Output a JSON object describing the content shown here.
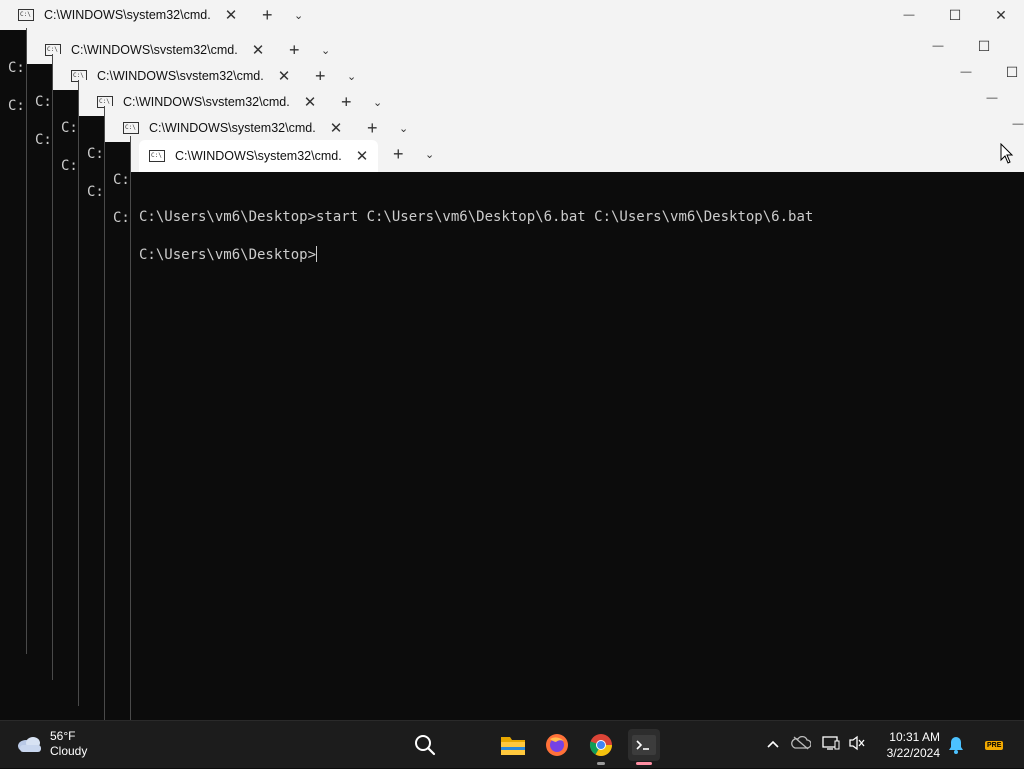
{
  "window_title": "C:\\WINDOWS\\system32\\cmd.",
  "background_peek_prompt": "C:",
  "console": {
    "line1": "C:\\Users\\vm6\\Desktop>start C:\\Users\\vm6\\Desktop\\6.bat C:\\Users\\vm6\\Desktop\\6.bat",
    "line2": "C:\\Users\\vm6\\Desktop>"
  },
  "tab_controls": {
    "close": "✕",
    "new_tab": "+",
    "dropdown": "⌄"
  },
  "window_controls": {
    "minimize": "—",
    "maximize": "☐",
    "close": "✕"
  },
  "taskbar": {
    "weather": {
      "temp": "56°F",
      "condition": "Cloudy"
    },
    "clock": {
      "time": "10:31 AM",
      "date": "3/22/2024"
    },
    "apps": [
      "search-icon",
      "file-explorer-icon",
      "firefox-icon",
      "chrome-icon",
      "terminal-icon"
    ],
    "badge": "PRE"
  },
  "colors": {
    "console_bg": "#0c0c0c",
    "console_fg": "#cccccc",
    "titlebar_bg": "#f3f3f3",
    "taskbar_bg": "#1c1c1c"
  }
}
